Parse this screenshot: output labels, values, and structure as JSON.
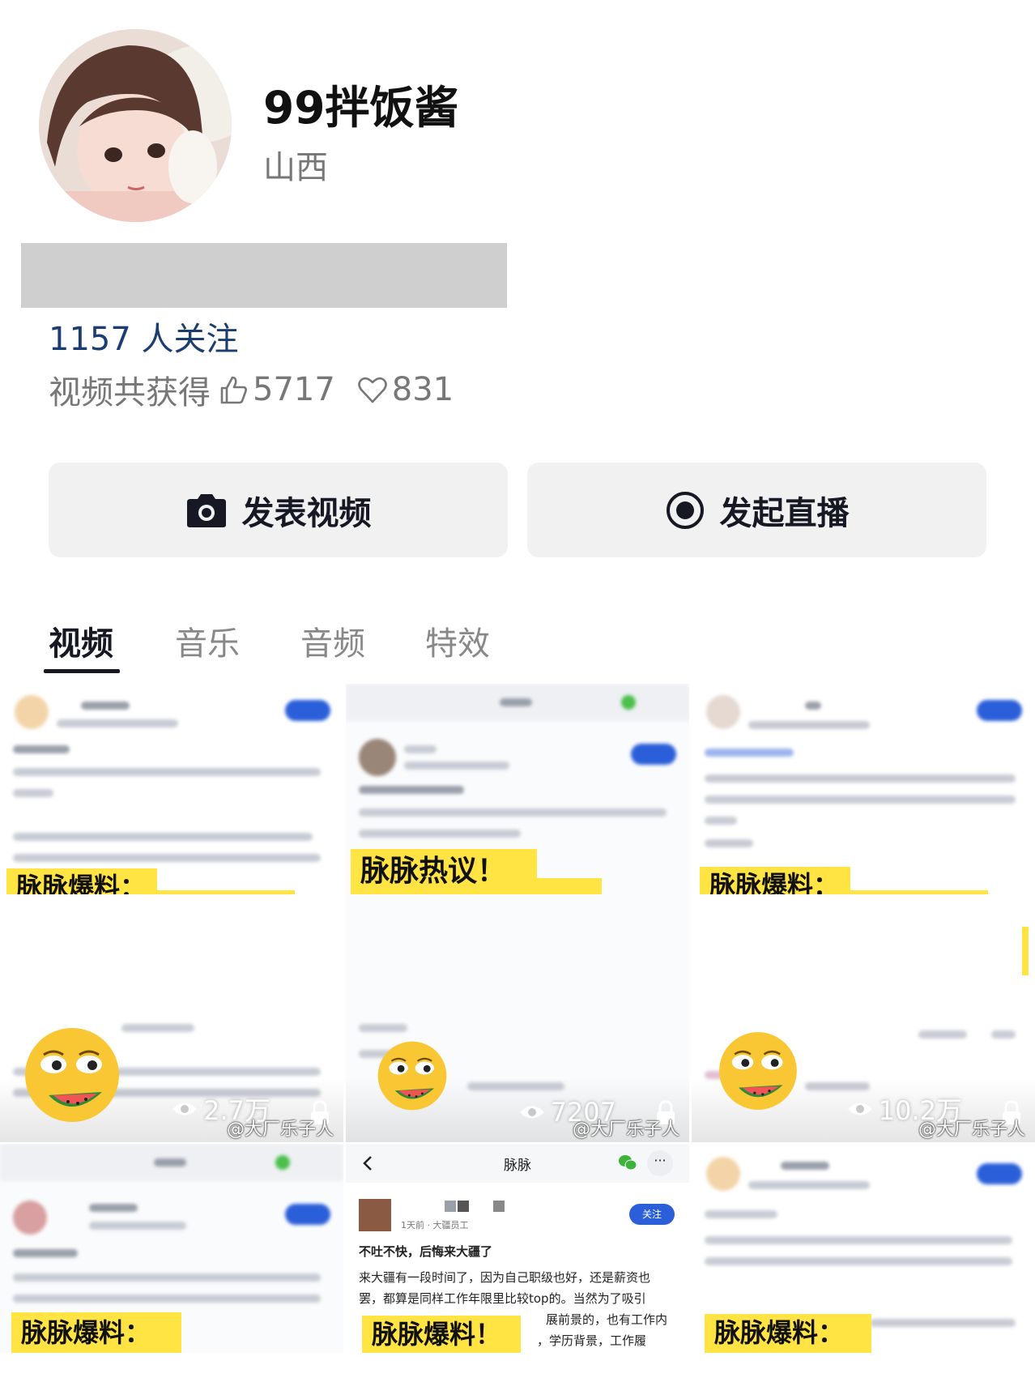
{
  "profile": {
    "name": "99拌饭酱",
    "region": "山西",
    "follow_text": "1157 人关注",
    "stats_label": "视频共获得",
    "likes": "5717",
    "hearts": "831"
  },
  "actions": {
    "post_video": "发表视频",
    "go_live": "发起直播"
  },
  "tabs": [
    "视频",
    "音乐",
    "音频",
    "特效"
  ],
  "videos": [
    {
      "banner": "脉脉爆料：",
      "views": "",
      "watermark": ""
    },
    {
      "banner": "脉脉热议！",
      "views": "",
      "watermark": ""
    },
    {
      "banner": "脉脉爆料：",
      "views": "",
      "watermark": ""
    },
    {
      "banner": "",
      "views": "2.7万",
      "watermark": "@大厂乐子人"
    },
    {
      "banner": "",
      "views": "7207",
      "watermark": "@大厂乐子人"
    },
    {
      "banner": "",
      "views": "10.2万",
      "watermark": "@大厂乐子人"
    },
    {
      "banner": "脉脉爆料：",
      "views": "",
      "watermark": ""
    },
    {
      "banner": "脉脉爆料！",
      "views": "",
      "watermark": "",
      "app_title": "脉脉",
      "post_meta": "1天前 · 大疆员工",
      "follow_btn": "关注",
      "post_title": "不吐不快，后悔来大疆了",
      "post_line1": "来大疆有一段时间了，因为自己职级也好，还是薪资也",
      "post_line2": "罢，都算是同样工作年限里比较top的。当然为了吸引",
      "post_line3": "展前景的，也有工作内",
      "post_line4": "，学历背景，工作履"
    },
    {
      "banner": "脉脉爆料：",
      "views": "",
      "watermark": ""
    }
  ],
  "colors": {
    "banner_yellow": "#ffe443",
    "follow_blue": "#1c3d72",
    "pill_blue": "#2b5fd9",
    "button_bg": "#f1f1f2"
  }
}
